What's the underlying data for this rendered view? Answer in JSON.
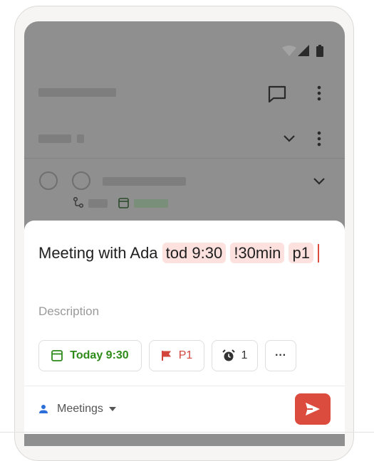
{
  "task": {
    "title_plain": "Meeting with Ada",
    "tokens": [
      "tod 9:30",
      "!30min",
      "p1"
    ],
    "description_placeholder": "Description"
  },
  "chips": {
    "date": "Today 9:30",
    "priority": "P1",
    "reminders": "1",
    "more": "···"
  },
  "footer": {
    "project": "Meetings"
  },
  "colors": {
    "accent": "#dc4c3e",
    "date_green": "#2e8b1a",
    "priority_red": "#d1453b",
    "token_bg": "#fde1de"
  }
}
